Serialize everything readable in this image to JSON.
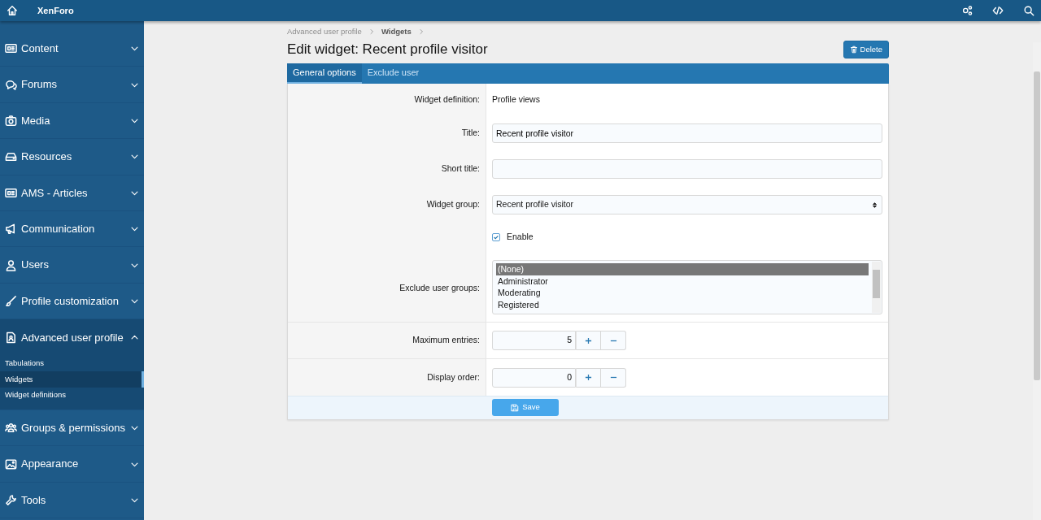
{
  "header": {
    "title": "XenForo"
  },
  "sidebar": {
    "items": [
      {
        "label": "Content",
        "expanded": false
      },
      {
        "label": "Forums",
        "expanded": false
      },
      {
        "label": "Media",
        "expanded": false
      },
      {
        "label": "Resources",
        "expanded": false
      },
      {
        "label": "AMS - Articles",
        "expanded": false
      },
      {
        "label": "Communication",
        "expanded": false
      },
      {
        "label": "Users",
        "expanded": false
      },
      {
        "label": "Profile customization",
        "expanded": false
      },
      {
        "label": "Advanced user profile",
        "expanded": true,
        "children": [
          {
            "label": "Tabulations",
            "selected": false
          },
          {
            "label": "Widgets",
            "selected": true
          },
          {
            "label": "Widget definitions",
            "selected": false
          }
        ]
      },
      {
        "label": "Groups & permissions",
        "expanded": false
      },
      {
        "label": "Appearance",
        "expanded": false
      },
      {
        "label": "Tools",
        "expanded": false
      }
    ]
  },
  "breadcrumb": [
    "Advanced user profile",
    "Widgets"
  ],
  "page_title": "Edit widget: Recent profile visitor",
  "delete_button": "Delete",
  "tabs": [
    {
      "label": "General options",
      "selected": true
    },
    {
      "label": "Exclude user",
      "selected": false
    }
  ],
  "form": {
    "rows": [
      {
        "kind": "static",
        "label": "Widget definition:",
        "value": "Profile views"
      },
      {
        "kind": "text",
        "label": "Title:",
        "value": "Recent profile visitor"
      },
      {
        "kind": "text",
        "label": "Short title:",
        "value": ""
      },
      {
        "kind": "select",
        "label": "Widget group:",
        "value": "Recent profile visitor"
      },
      {
        "kind": "checkbox",
        "text": "Enable",
        "checked": true
      },
      {
        "kind": "listbox",
        "label": "Exclude user groups:",
        "options": [
          {
            "label": "(None)",
            "selected": true
          },
          {
            "label": "Administrator",
            "selected": false
          },
          {
            "label": "Moderating",
            "selected": false
          },
          {
            "label": "Registered",
            "selected": false
          }
        ]
      },
      {
        "kind": "spinner",
        "label": "Maximum entries:",
        "value": "5"
      },
      {
        "kind": "spinner",
        "label": "Display order:",
        "value": "0"
      }
    ]
  },
  "save_button": "Save"
}
